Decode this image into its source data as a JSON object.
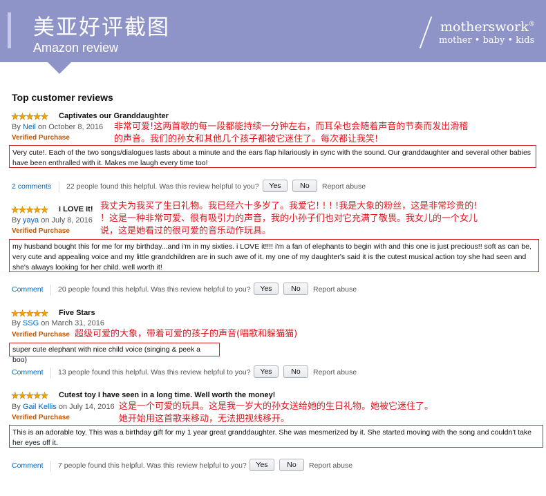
{
  "banner": {
    "title": "美亚好评截图",
    "subtitle": "Amazon review",
    "logo_main": "motherswork",
    "logo_reg": "®",
    "logo_tagline": "mother • baby • kids"
  },
  "heading": "Top customer reviews",
  "colors": {
    "star": "#f4a300",
    "link": "#0066c0",
    "verified": "#c45500",
    "annotation": "#e0161f",
    "banner": "#8f94c8"
  },
  "reviews": [
    {
      "stars": "★★★★★",
      "title": "Captivates our Granddaughter",
      "by": "By",
      "author": "Neil",
      "date": "on October 8, 2016",
      "verified": "Verified Purchase",
      "translation": "非常可爱!这两首歌的每一段都能持续一分钟左右，而耳朵也会随着声音的节奏而发出滑稽的声音。我们的孙女和其他几个孩子都被它迷住了。每次都让我笑!",
      "translation_lines": [
        "非常可爱!这两首歌的每一段都能持续一分钟左右，而耳朵也会随着声音的节奏而发出滑稽",
        "的声音。我们的孙女和其他几个孩子都被它迷住了。每次都让我笑!"
      ],
      "text": "Very cute!. Each of the two songs/dialogues lasts about a minute and the ears flap hilariously in sync with the sound. Our granddaughter and several other babies have been enthralled with it. Makes me laugh every time too!",
      "comment_label": "2 comments",
      "helpful": "22 people found this helpful. Was this review helpful to you?",
      "yes": "Yes",
      "no": "No",
      "report": "Report abuse"
    },
    {
      "stars": "★★★★★",
      "title": "i LOVE it!",
      "by": "By",
      "author": "yaya",
      "date": "on July 8, 2016",
      "verified": "Verified Purchase",
      "translation_lines": [
        "我丈夫为我买了生日礼物。我已经六十多岁了。我爱它! ! ! !我是大象的粉丝，这是非常珍贵的!",
        "！这是一种非常可爱、很有吸引力的声音，我的小孙子们也对它充满了敬畏。我女儿的一个女儿",
        "说，这是她看过的很可爱的音乐动作玩具。"
      ],
      "text": "my husband bought this for me for my birthday...and i'm in my sixties. i LOVE it!!!! i'm a fan of elephants to begin with and this one is just precious!! soft as can be, very cute and appealing voice and my little grandchildren are in such awe of it. my one of my daughter's said it is the cutest musical action toy she had seen and she's always looking for her child. well worth it!",
      "comment_label": "Comment",
      "helpful": "20 people found this helpful. Was this review helpful to you?",
      "yes": "Yes",
      "no": "No",
      "report": "Report abuse"
    },
    {
      "stars": "★★★★★",
      "title": "Five Stars",
      "by": "By",
      "author": "SSG",
      "date": "on March 31, 2016",
      "verified": "Verified Purchase",
      "translation_lines": [
        "超级可爱的大象，带着可爱的孩子的声音(唱歌和躲猫猫)"
      ],
      "text": "super cute elephant with nice child voice (singing & peek a boo)",
      "comment_label": "Comment",
      "helpful": "13 people found this helpful. Was this review helpful to you?",
      "yes": "Yes",
      "no": "No",
      "report": "Report abuse"
    },
    {
      "stars": "★★★★★",
      "title": "Cutest toy I have seen in a long time. Well worth the money!",
      "by": "By",
      "author": "Gail Kellis",
      "date": "on July 14, 2016",
      "verified": "Verified Purchase",
      "translation_lines": [
        "这是一个可爱的玩具。这是我一岁大的孙女送给她的生日礼物。她被它迷住了。",
        "她开始用这首歌来移动，无法把视线移开。"
      ],
      "text": "This is an adorable toy. This was a birthday gift for my 1 year great granddaughter. She was mesmerized by it. She started moving with the song and couldn't take her eyes off it.",
      "comment_label": "Comment",
      "helpful": "7 people found this helpful. Was this review helpful to you?",
      "yes": "Yes",
      "no": "No",
      "report": "Report abuse"
    }
  ]
}
